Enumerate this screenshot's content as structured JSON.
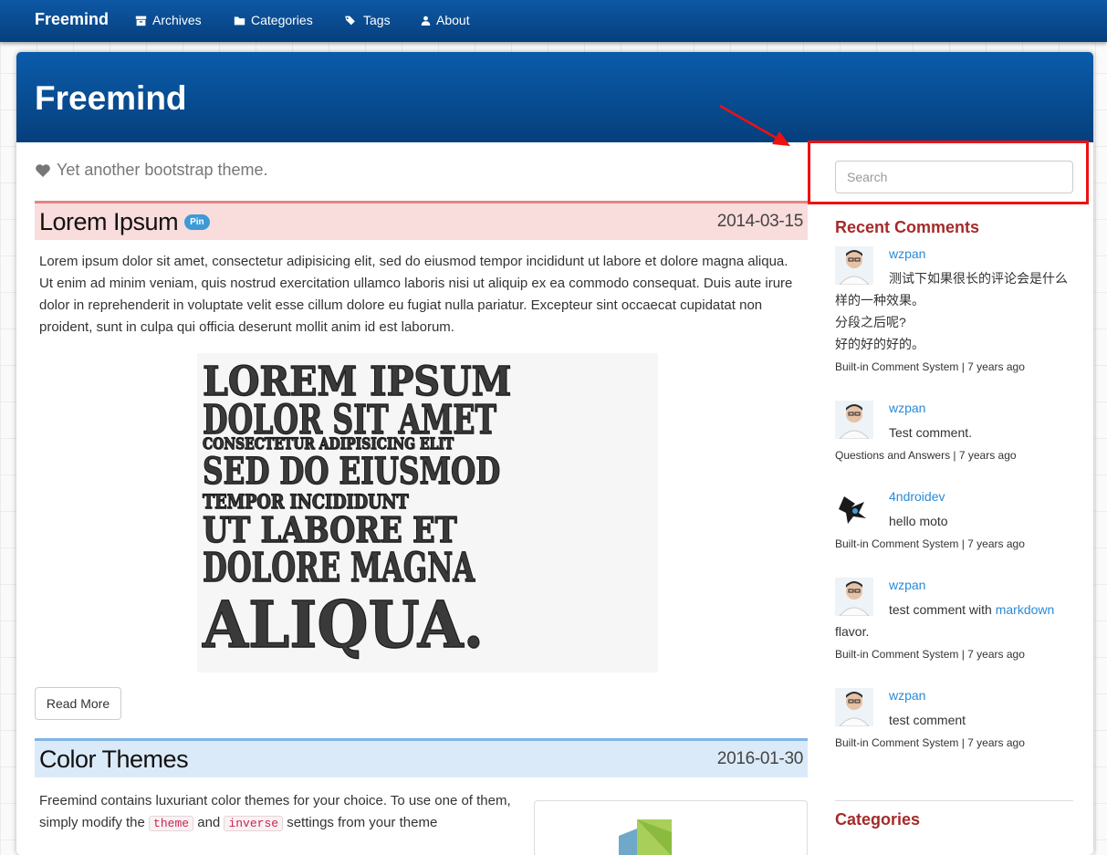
{
  "navbar": {
    "brand": "Freemind",
    "items": [
      {
        "label": "Archives",
        "icon": "archive-icon"
      },
      {
        "label": "Categories",
        "icon": "folder-icon"
      },
      {
        "label": "Tags",
        "icon": "tags-icon"
      },
      {
        "label": "About",
        "icon": "user-icon"
      }
    ]
  },
  "header": {
    "site_title": "Freemind",
    "tagline": "Yet another bootstrap theme."
  },
  "posts": [
    {
      "title": "Lorem Ipsum",
      "badge": "Pin",
      "date": "2014-03-15",
      "excerpt": "Lorem ipsum dolor sit amet, consectetur adipisicing elit, sed do eiusmod tempor incididunt ut labore et dolore magna aliqua. Ut enim ad minim veniam, quis nostrud exercitation ullamco laboris nisi ut aliquip ex ea commodo consequat. Duis aute irure dolor in reprehenderit in voluptate velit esse cillum dolore eu fugiat nulla pariatur. Excepteur sint occaecat cupidatat non proident, sunt in culpa qui officia deserunt mollit anim id est laborum.",
      "image_lines": [
        "LOREM IPSUM",
        "DOLOR SIT AMET",
        "CONSECTETUR ADIPISICING ELIT",
        "SED DO EIUSMOD",
        "TEMPOR INCIDIDUNT",
        "UT LABORE ET",
        "DOLORE MAGNA",
        "ALIQUA."
      ],
      "read_more": "Read More"
    },
    {
      "title": "Color Themes",
      "date": "2016-01-30",
      "excerpt_part1": "Freemind contains luxuriant color themes for your choice. To use one of them, simply modify the",
      "code1": "theme",
      "excerpt_and": "and",
      "code2": "inverse",
      "excerpt_part2": "settings from your theme"
    }
  ],
  "sidebar": {
    "search_placeholder": "Search",
    "recent_comments_title": "Recent Comments",
    "comments": [
      {
        "author": "wzpan",
        "text_lines": [
          "测试下如果很长的评论会是什么样的一种效果。",
          "分段之后呢?",
          "好的好的好的。"
        ],
        "source": "Built-in Comment System",
        "time": "7 years ago"
      },
      {
        "author": "wzpan",
        "text_lines": [
          "Test comment."
        ],
        "source": "Questions and Answers",
        "time": "7 years ago"
      },
      {
        "author": "4ndroidev",
        "text_lines": [
          "hello moto"
        ],
        "source": "Built-in Comment System",
        "time": "7 years ago"
      },
      {
        "author": "wzpan",
        "text_before_link": "test comment with",
        "link_text": "markdown",
        "text_after_link": "flavor.",
        "source": "Built-in Comment System",
        "time": "7 years ago"
      },
      {
        "author": "wzpan",
        "text_lines": [
          "test comment"
        ],
        "source": "Built-in Comment System",
        "time": "7 years ago"
      }
    ],
    "categories_title": "Categories"
  },
  "colors": {
    "navbar": "#063f7c",
    "accent_red": "#a52a2a",
    "link": "#2a8ad8",
    "annotation": "#ee1111"
  }
}
